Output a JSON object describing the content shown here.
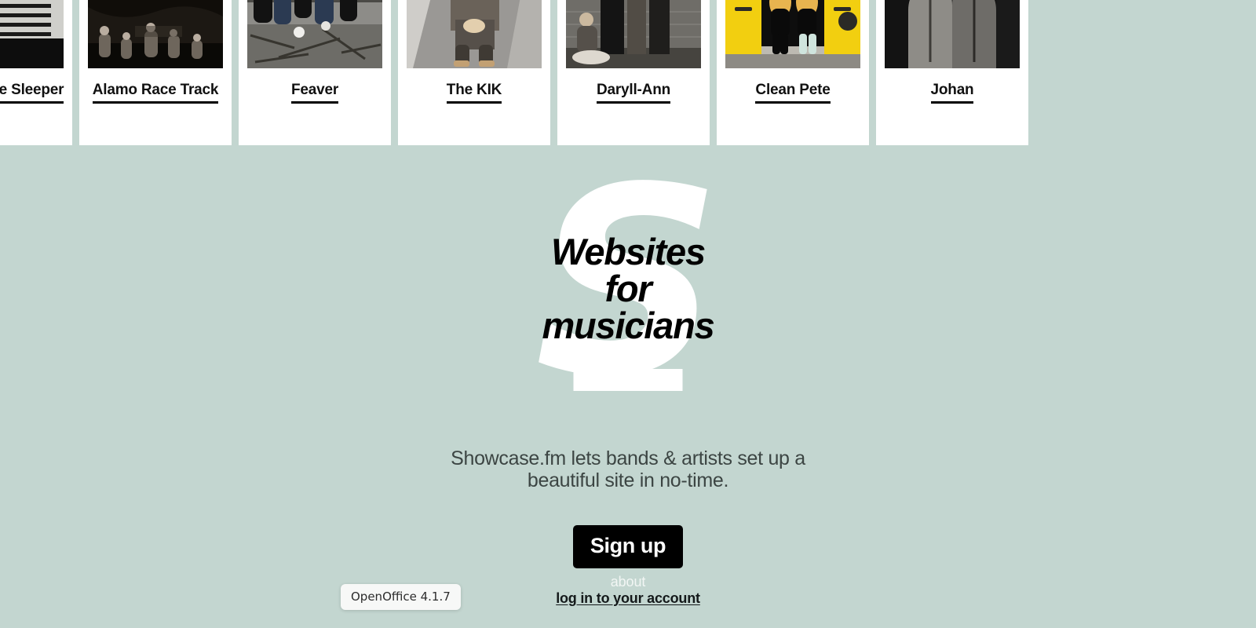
{
  "background_color": "#c3d6d0",
  "carousel": {
    "cards": [
      {
        "band": "Lighthouse Sleeper",
        "partial": "left",
        "photo_style": "stripes"
      },
      {
        "band": "Alamo Race Track",
        "partial": "none",
        "photo_style": "forest"
      },
      {
        "band": "Feaver",
        "partial": "none",
        "photo_style": "rubble"
      },
      {
        "band": "The KIK",
        "partial": "none",
        "photo_style": "street"
      },
      {
        "band": "Daryll-Ann",
        "partial": "none",
        "photo_style": "wall"
      },
      {
        "band": "Clean Pete",
        "partial": "none",
        "photo_style": "van"
      },
      {
        "band": "Johan",
        "partial": "right",
        "photo_style": "hoodie"
      }
    ]
  },
  "hero": {
    "logo_letter": "S",
    "heading_lines": [
      "Websites",
      "for",
      "musicians"
    ],
    "heading_color": "#000000",
    "logo_color": "#ffffff"
  },
  "tagline": {
    "line1": "Showcase.fm lets bands & artists set up a",
    "line2": "beautiful site in no-time.",
    "color": "#3c4543"
  },
  "actions": {
    "signup_label": "Sign up",
    "signup_bg": "#000000",
    "signup_text_color": "#ffffff",
    "about_label": "about",
    "about_color": "#f2f6f4",
    "login_label": "log in to your account",
    "login_color": "#14191a"
  },
  "os_tooltip": {
    "label": "OpenOffice 4.1.7"
  }
}
